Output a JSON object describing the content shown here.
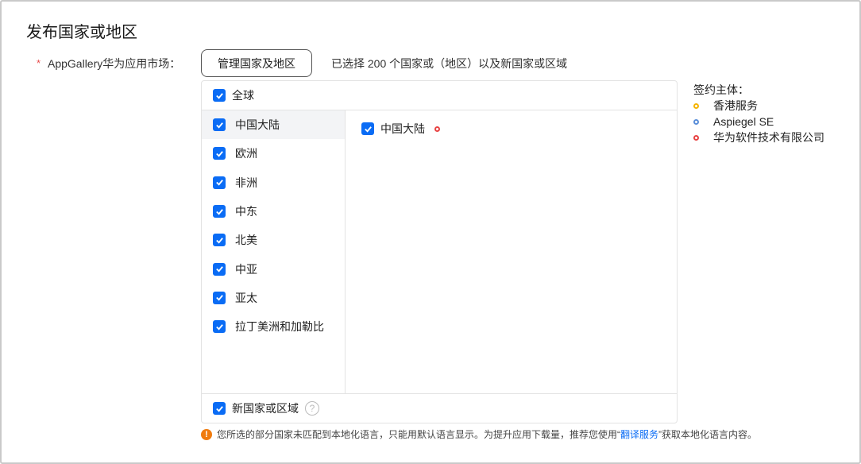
{
  "title": "发布国家或地区",
  "field": {
    "required_mark": "*",
    "label": "AppGallery华为应用市场：",
    "manage_button": "管理国家及地区",
    "status": "已选择 200 个国家或（地区）以及新国家或区域"
  },
  "panel": {
    "global": {
      "label": "全球",
      "checked": true
    },
    "regions": [
      {
        "label": "中国大陆",
        "checked": true,
        "active": true
      },
      {
        "label": "欧洲",
        "checked": true
      },
      {
        "label": "非洲",
        "checked": true
      },
      {
        "label": "中东",
        "checked": true
      },
      {
        "label": "北美",
        "checked": true
      },
      {
        "label": "中亚",
        "checked": true
      },
      {
        "label": "亚太",
        "checked": true
      },
      {
        "label": "拉丁美洲和加勒比",
        "checked": true
      }
    ],
    "countries": [
      {
        "label": "中国大陆",
        "checked": true,
        "entity_color": "#e84343"
      }
    ],
    "new_regions": {
      "label": "新国家或区域",
      "checked": true,
      "help": "?"
    }
  },
  "legend": {
    "title": "签约主体：",
    "items": [
      {
        "label": "香港服务",
        "color": "#f5b400"
      },
      {
        "label": "Aspiegel SE",
        "color": "#5b8fd9"
      },
      {
        "label": "华为软件技术有限公司",
        "color": "#e84343"
      }
    ]
  },
  "warning": {
    "icon": "!",
    "before": "您所选的部分国家未匹配到本地化语言，只能用默认语言显示。为提升应用下载量，推荐您使用“",
    "link": "翻译服务",
    "after": "”获取本地化语言内容。"
  }
}
